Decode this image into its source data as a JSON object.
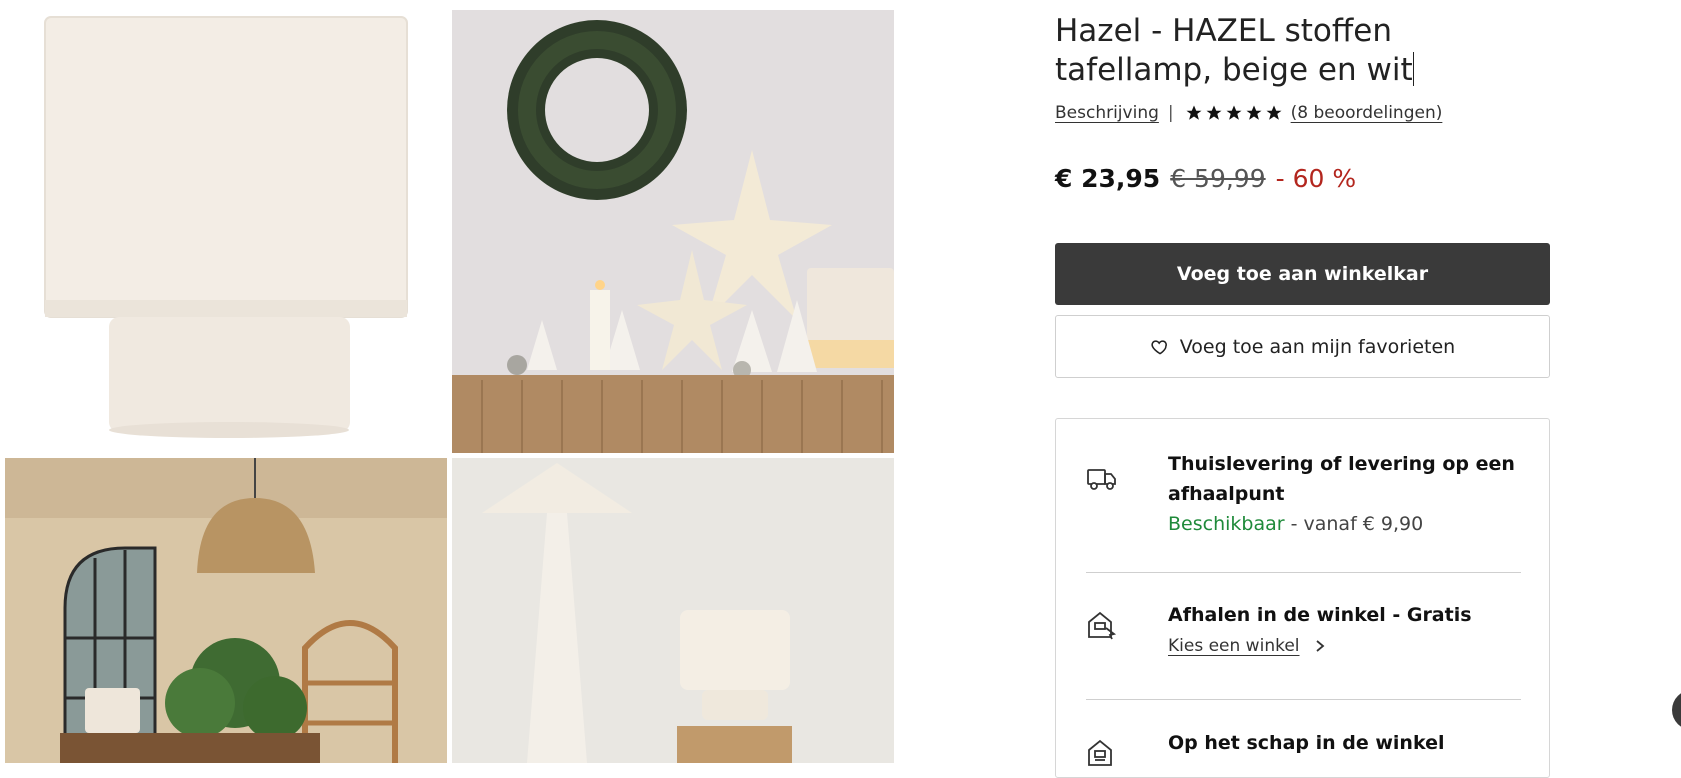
{
  "gallery": {
    "images": [
      {
        "alt": "beige fabric lamp product shot"
      },
      {
        "alt": "christmas mantel with wreath, paper stars and lamp"
      },
      {
        "alt": "room with rattan pendant and shelves"
      },
      {
        "alt": "white floor lamp and table lamp on wooden stand"
      }
    ]
  },
  "product": {
    "title": "Hazel - HAZEL stoffen tafellamp, beige en wit",
    "description_link": "Beschrijving",
    "separator": "|",
    "rating_stars": 5,
    "reviews_link": "(8 beoordelingen)",
    "price_now": "€ 23,95",
    "price_old": "€ 59,99",
    "discount": "- 60 %"
  },
  "actions": {
    "add_to_cart": "Voeg toe aan winkelkar",
    "add_to_favorites": "Voeg toe aan mijn favorieten"
  },
  "delivery": {
    "home": {
      "title": "Thuislevering of levering op een afhaalpunt",
      "status": "Beschikbaar",
      "detail": " - vanaf € 9,90",
      "icon": "truck-icon"
    },
    "pickup": {
      "title": "Afhalen in de winkel - Gratis",
      "link": "Kies een winkel",
      "icon": "store-pickup-icon"
    },
    "shelf": {
      "title": "Op het schap in de winkel",
      "icon": "store-icon"
    }
  },
  "colors": {
    "primary_button": "#3a3a3a",
    "discount": "#b3261e",
    "available": "#1f8a3a"
  }
}
